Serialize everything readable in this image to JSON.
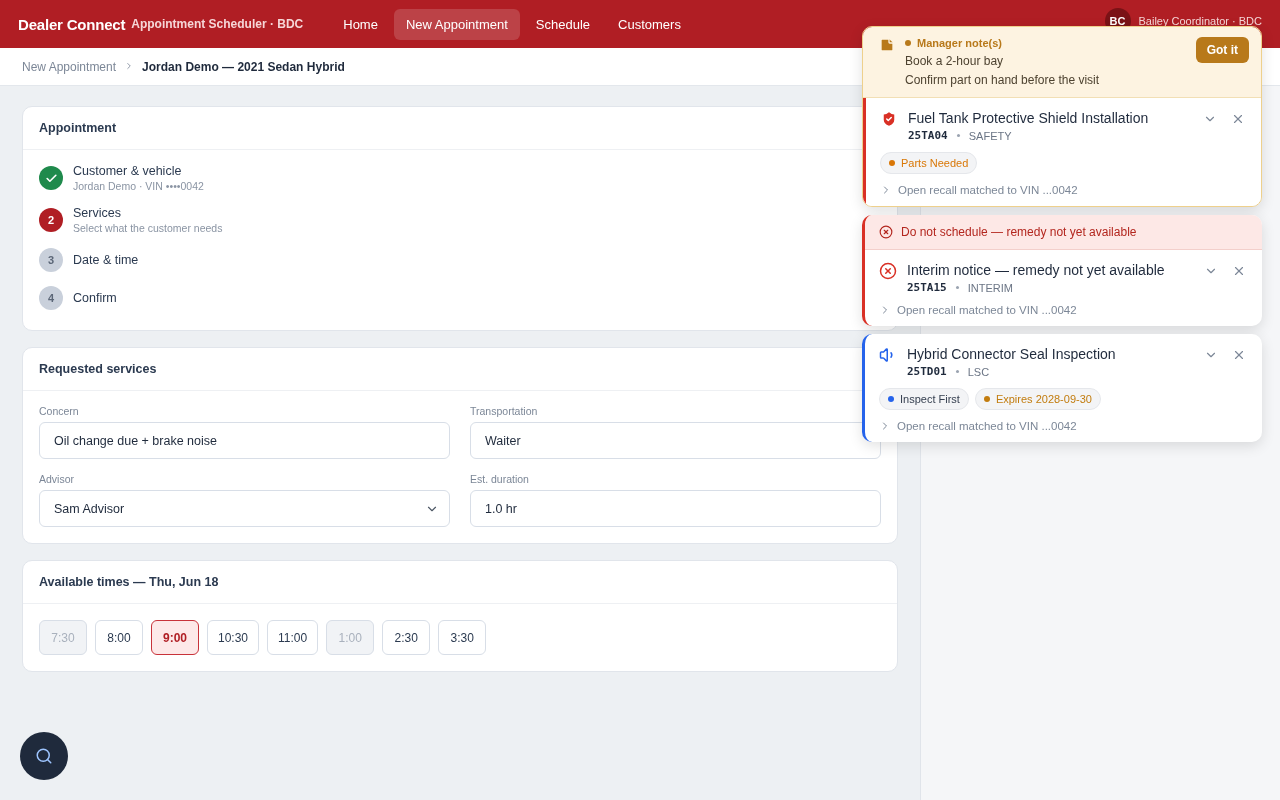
{
  "header": {
    "brand": "Dealer Connect",
    "subtitle": "Appointment Scheduler · BDC",
    "nav": [
      {
        "label": "Home",
        "selected": false
      },
      {
        "label": "New Appointment",
        "selected": true
      },
      {
        "label": "Schedule",
        "selected": false
      },
      {
        "label": "Customers",
        "selected": false
      }
    ],
    "user": {
      "initials": "BC",
      "name": "Bailey Coordinator · BDC"
    }
  },
  "breadcrumb": [
    {
      "label": "New Appointment",
      "current": false
    },
    {
      "label": "Jordan Demo — 2021 Sedan Hybrid",
      "current": true
    }
  ],
  "appointment": {
    "title": "Appointment",
    "steps": [
      {
        "title": "Customer & vehicle",
        "subtitle": "Jordan Demo · VIN ••••0042",
        "completed": true,
        "selected": false
      },
      {
        "number": "2",
        "title": "Services",
        "subtitle": "Select what the customer needs",
        "completed": false,
        "selected": true
      },
      {
        "number": "3",
        "title": "Date & time",
        "completed": false,
        "selected": false
      },
      {
        "number": "4",
        "title": "Confirm",
        "completed": false,
        "selected": false
      }
    ]
  },
  "services": {
    "title": "Requested services",
    "fields": [
      {
        "label": "Concern",
        "value": "Oil change due + brake noise",
        "kind": "text"
      },
      {
        "label": "Transportation",
        "value": "Waiter",
        "kind": "text"
      },
      {
        "label": "Advisor",
        "value": "Sam Advisor",
        "kind": "select"
      },
      {
        "label": "Est. duration",
        "value": "1.0 hr",
        "kind": "text"
      }
    ]
  },
  "times": {
    "title": "Available times — Thu, Jun 18",
    "slots": [
      {
        "label": "7:30",
        "selected": false,
        "disabled": true
      },
      {
        "label": "8:00",
        "selected": false,
        "disabled": false
      },
      {
        "label": "9:00",
        "selected": true,
        "disabled": false
      },
      {
        "label": "10:30",
        "selected": false,
        "disabled": false
      },
      {
        "label": "11:00",
        "selected": false,
        "disabled": false
      },
      {
        "label": "1:00",
        "selected": false,
        "disabled": true
      },
      {
        "label": "2:30",
        "selected": false,
        "disabled": false
      },
      {
        "label": "3:30",
        "selected": false,
        "disabled": false
      }
    ]
  },
  "alerts": {
    "note": {
      "label": "Manager note(s)",
      "lines": [
        "Book a 2-hour bay",
        "Confirm part on hand before the visit"
      ],
      "button": "Got it"
    },
    "recalls": [
      {
        "kind": "safety",
        "color": "#d93025",
        "title": "Fuel Tank Protective Shield Installation",
        "code": "25TA04",
        "category": "SAFETY",
        "tags": [
          {
            "label": "Parts Needed",
            "color": "#d97706"
          }
        ],
        "footer": "Open recall matched to VIN ...0042"
      },
      {
        "kind": "interim",
        "color": "#d93025",
        "banner": "Do not schedule — remedy not yet available",
        "title": "Interim notice — remedy not yet available",
        "code": "25TA15",
        "category": "INTERIM",
        "footer": "Open recall matched to VIN ...0042"
      },
      {
        "kind": "lsc",
        "color": "#2563eb",
        "title": "Hybrid Connector Seal Inspection",
        "code": "25TD01",
        "category": "LSC",
        "tags": [
          {
            "label": "Inspect First",
            "color": "#2563eb"
          },
          {
            "label": "Expires 2028-09-30",
            "color": "#c27c0e"
          }
        ],
        "footer": "Open recall matched to VIN ...0042"
      }
    ]
  }
}
